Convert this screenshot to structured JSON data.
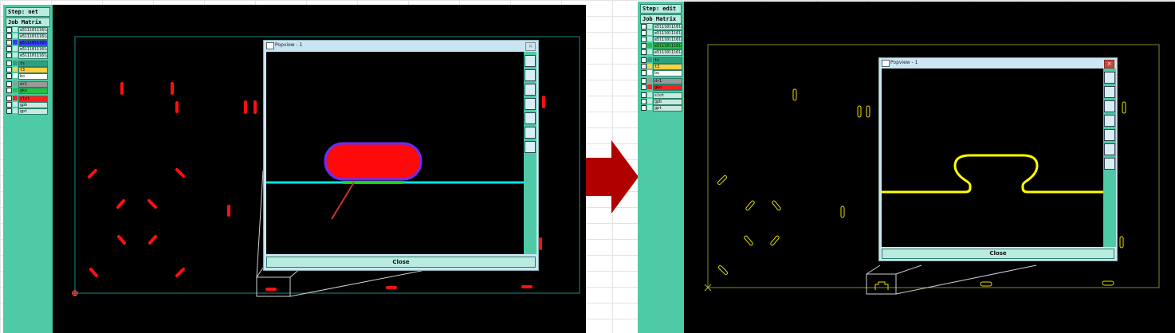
{
  "left": {
    "step_label": "Step: net",
    "job_matrix_label": "Job Matrix ...",
    "popview_title": "Popview - 1",
    "close_label": "Close",
    "layers": [
      {
        "name": "e5l1l0l1l6làø",
        "color": "#c8e8e0"
      },
      {
        "name": "e5l1l0l1l6làø",
        "color": "#c8e8e0"
      },
      {
        "name": "e5l1l0l1l6làø",
        "color": "#3a3aff"
      },
      {
        "name": "e5l1l0l1l6làø",
        "color": "#c8e8e0"
      },
      {
        "name": "e5l1l0l1l6làø",
        "color": "#c8e8e0"
      },
      {
        "name": "ts",
        "color": "#2ea080"
      },
      {
        "name": "t3",
        "color": "#ffd040"
      },
      {
        "name": "bo",
        "color": "#ffffff"
      },
      {
        "name": "dr1",
        "color": "#999999"
      },
      {
        "name": "gko",
        "color": "#26c040"
      },
      {
        "name": "slot",
        "color": "#ff2020"
      },
      {
        "name": "gpb",
        "color": "#c8e8e0"
      },
      {
        "name": "gpt",
        "color": "#c8e8e0"
      }
    ]
  },
  "right": {
    "step_label": "Step: edit",
    "job_matrix_label": "Job Matrix ...",
    "popview_title": "Popview - 1",
    "close_label": "Close",
    "layers": [
      {
        "name": "e5l1l0l1l6làø",
        "color": "#c8e8e0"
      },
      {
        "name": "e5l1l0l1l6làø",
        "color": "#c8e8e0"
      },
      {
        "name": "e5l1l0l1l6làø",
        "color": "#c8e8e0"
      },
      {
        "name": "e5l1l0l1l6làø",
        "color": "#26c040"
      },
      {
        "name": "e5l1l0l1l6làø",
        "color": "#c8e8e0"
      },
      {
        "name": "ts",
        "color": "#2ea080"
      },
      {
        "name": "t3",
        "color": "#ffd040"
      },
      {
        "name": "bo",
        "color": "#ffffff"
      },
      {
        "name": "dr1",
        "color": "#999999"
      },
      {
        "name": "gko",
        "color": "#ff2020"
      },
      {
        "name": "slot",
        "color": "#c8e8e0"
      },
      {
        "name": "gpb",
        "color": "#c8e8e0"
      },
      {
        "name": "gpt",
        "color": "#c8e8e0"
      }
    ]
  },
  "colors": {
    "panel": "#4fcaa6",
    "slot_before": "#ff1010",
    "slot_after": "#ffff00",
    "board_outline_before": "#1d8a86",
    "board_outline_after": "#8a8a20",
    "arrow": "#b00000"
  },
  "icons": [
    "popview-tool-icon",
    "right-arrow-icon",
    "window-close-icon"
  ]
}
